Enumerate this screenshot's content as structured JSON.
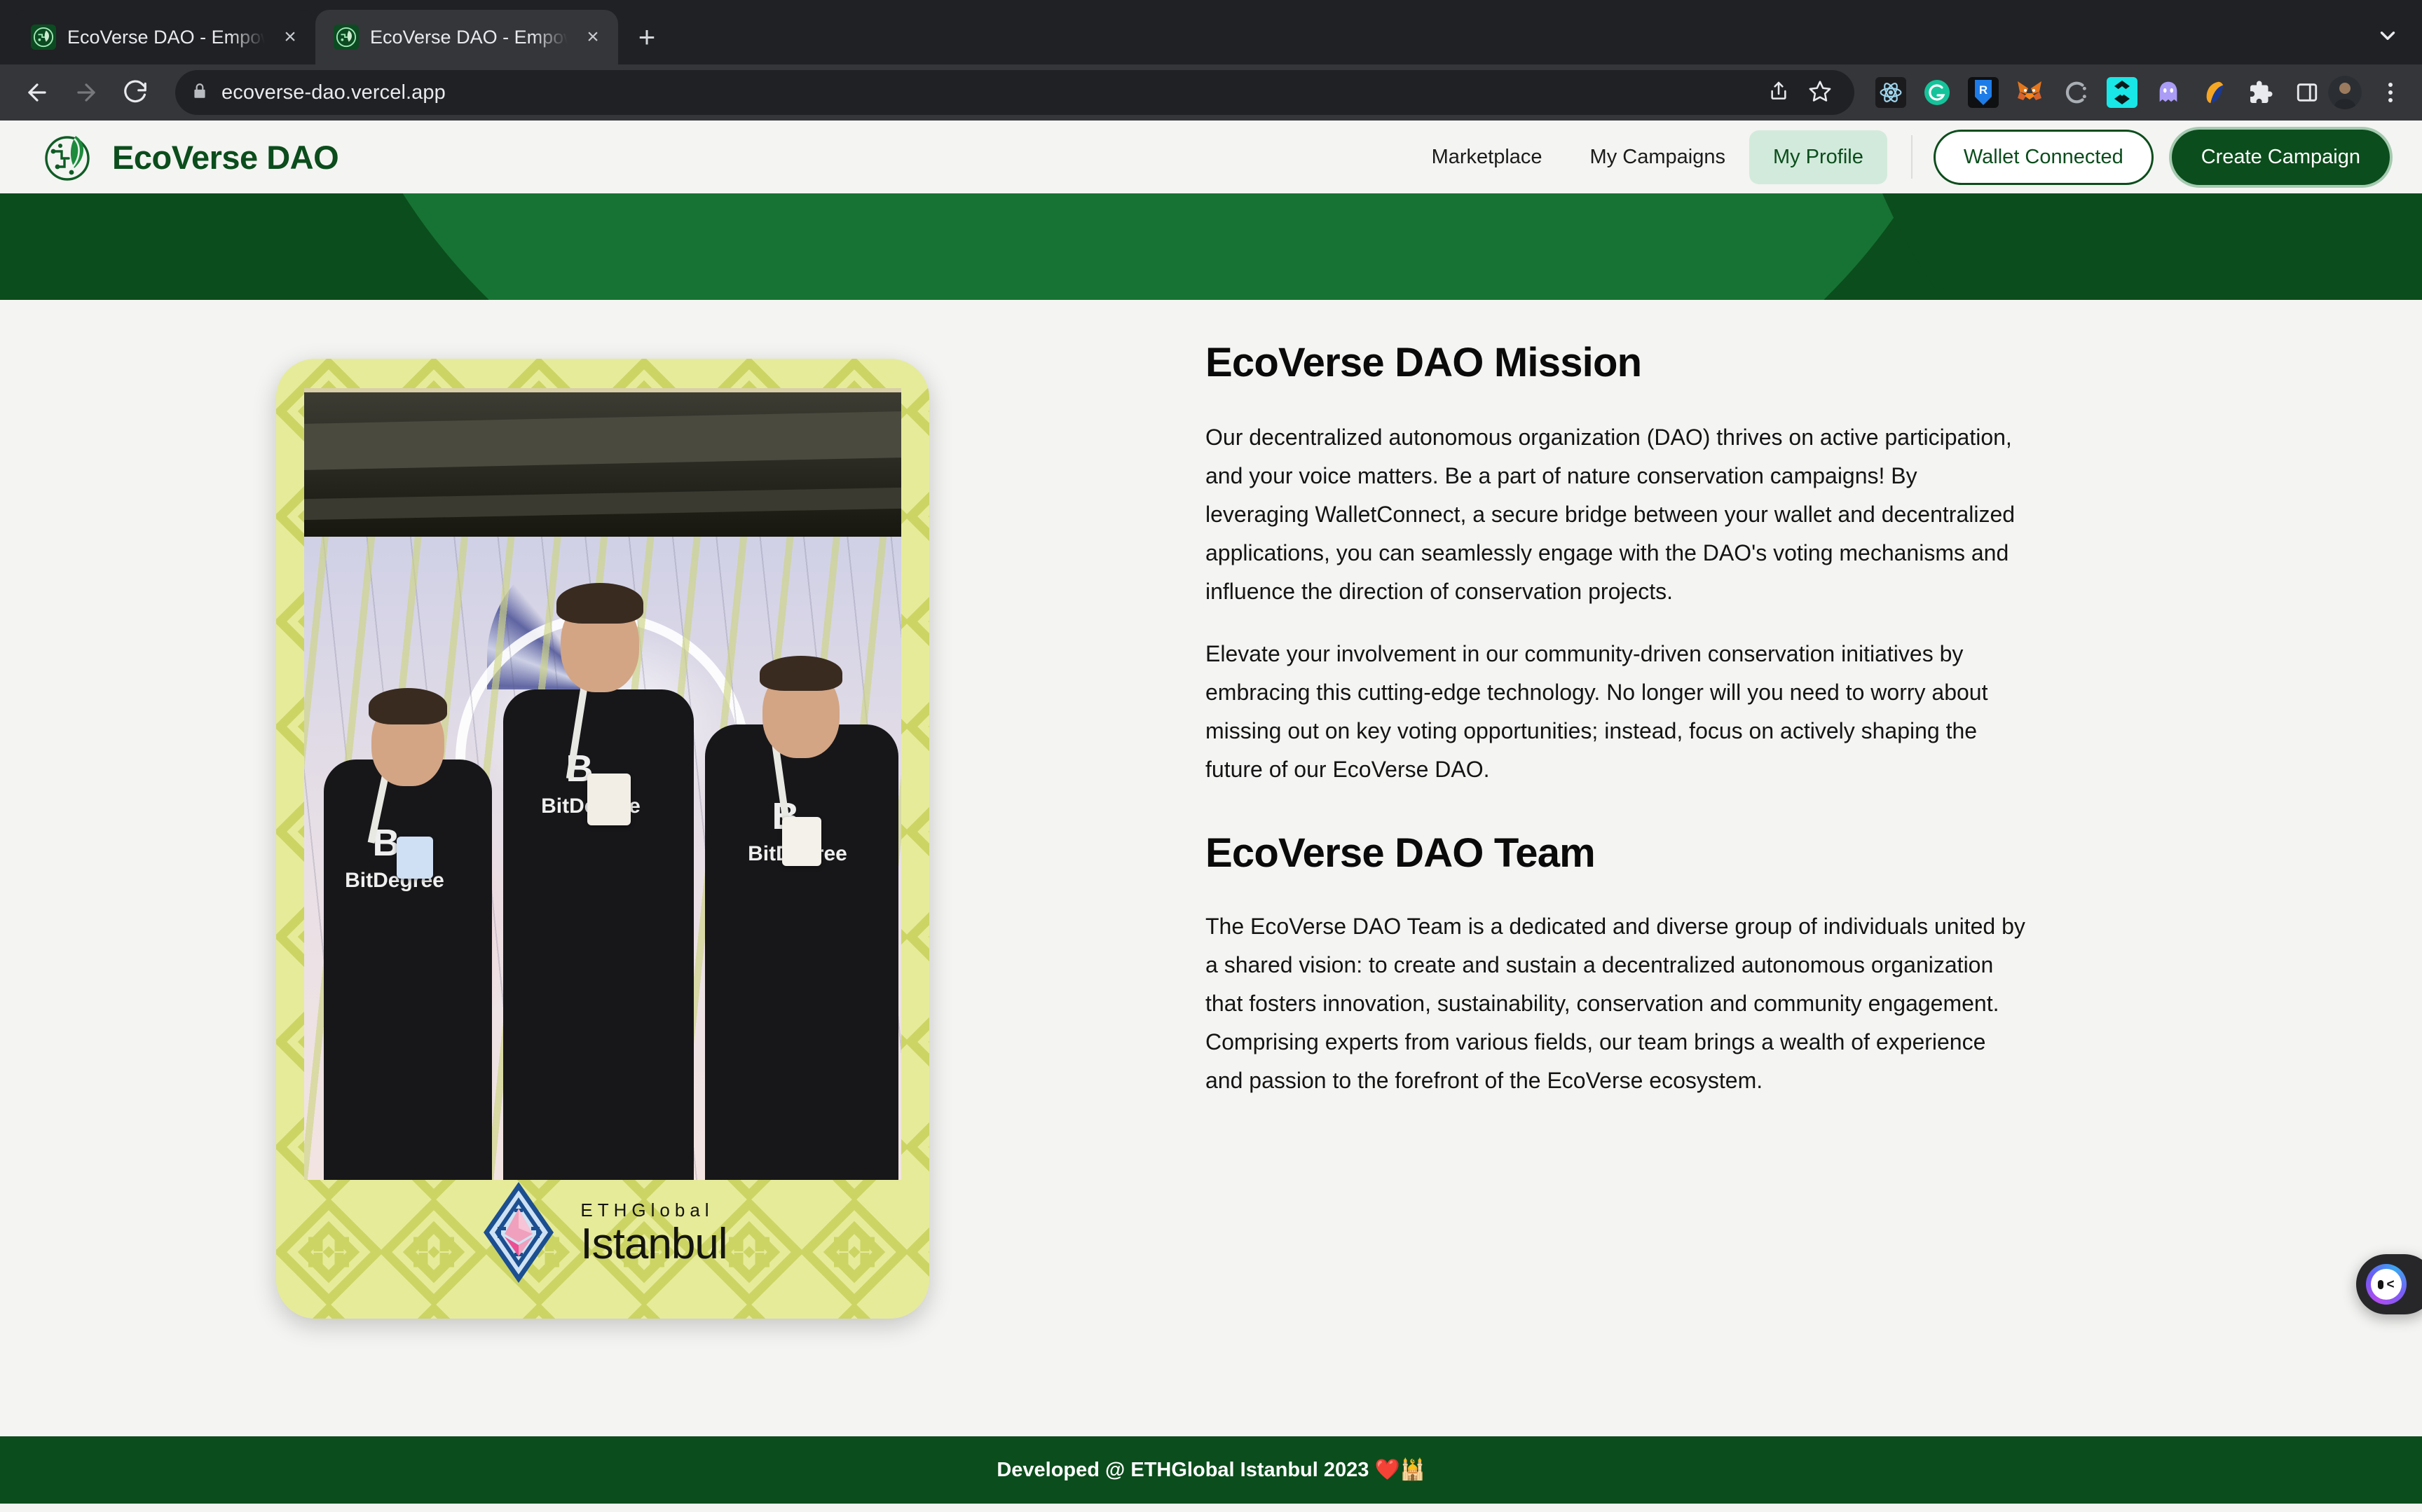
{
  "browser": {
    "tabs": [
      {
        "title": "EcoVerse DAO - Empowering E",
        "favicon": "ecoverse-leaf-icon",
        "active": false
      },
      {
        "title": "EcoVerse DAO - Empowering E",
        "favicon": "ecoverse-leaf-icon",
        "active": true
      }
    ],
    "new_tab_label": "+",
    "close_label": "×",
    "nav": {
      "back": "←",
      "forward": "→",
      "reload": "↻"
    },
    "omnibox": {
      "url": "ecoverse-dao.vercel.app",
      "lock_icon": "lock-icon",
      "share_icon": "share-icon",
      "bookmark_icon": "star-icon"
    },
    "extensions": [
      "react-devtools-icon",
      "grammarly-icon",
      "rabby-wallet-icon",
      "metamask-icon",
      "coinbase-wallet-icon",
      "phantom-alt-icon",
      "ghost-wallet-icon",
      "rainbow-wallet-icon",
      "extensions-puzzle-icon",
      "side-panel-icon"
    ],
    "profile_icon": "user-avatar",
    "menu_icon": "kebab-menu-icon",
    "tab_search_icon": "chevron-down-icon"
  },
  "site": {
    "brand": {
      "logo_icon": "ecoverse-circuit-leaf-logo",
      "name": "EcoVerse DAO"
    },
    "nav": {
      "links": [
        {
          "label": "Marketplace",
          "active": false
        },
        {
          "label": "My Campaigns",
          "active": false
        },
        {
          "label": "My Profile",
          "active": true
        }
      ],
      "wallet_button": "Wallet Connected",
      "create_button": "Create Campaign"
    },
    "colors": {
      "brand_dark_green": "#0b4d1c",
      "brand_mid_green": "#177334",
      "active_pill_bg": "#d2eadb",
      "page_bg": "#f4f4f2",
      "card_bg": "#e6eb9a",
      "card_pattern": "#ccd464"
    }
  },
  "photo_card": {
    "alt": "EcoVerse DAO team of three at ETHGlobal Istanbul",
    "hoodie_text": "BitDegree",
    "event_logo_icon": "ethglobal-istanbul-diamond-logo",
    "event_brand": "ETHGlobal",
    "event_city": "Istanbul"
  },
  "content": {
    "mission": {
      "heading": "EcoVerse DAO Mission",
      "paragraphs": [
        "Our decentralized autonomous organization (DAO) thrives on active participation, and your voice matters. Be a part of nature conservation campaigns! By leveraging WalletConnect, a secure bridge between your wallet and decentralized applications, you can seamlessly engage with the DAO's voting mechanisms and influence the direction of conservation projects.",
        "Elevate your involvement in our community-driven conservation initiatives by embracing this cutting-edge technology. No longer will you need to worry about missing out on key voting opportunities; instead, focus on actively shaping the future of our EcoVerse DAO."
      ]
    },
    "team": {
      "heading": "EcoVerse DAO Team",
      "paragraphs": [
        "The EcoVerse DAO Team is a dedicated and diverse group of individuals united by a shared vision: to create and sustain a decentralized autonomous organization that fosters innovation, sustainability, conservation and community engagement. Comprising experts from various fields, our team brings a wealth of experience and passion to the forefront of the EcoVerse ecosystem."
      ]
    }
  },
  "footer": {
    "text": "Developed @ ETHGlobal Istanbul 2023 ❤️🕌"
  },
  "chat_widget": {
    "icon": "chat-bubble-face-icon",
    "label": ""
  }
}
